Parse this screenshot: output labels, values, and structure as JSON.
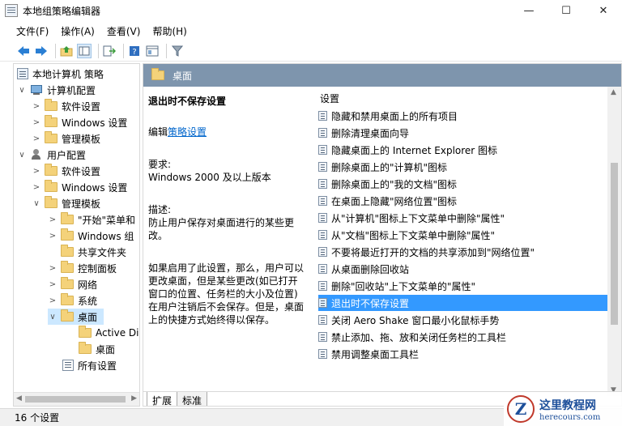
{
  "window": {
    "title": "本地组策略编辑器",
    "minimize_glyph": "—",
    "maximize_glyph": "☐",
    "close_glyph": "✕"
  },
  "menu": [
    "文件(F)",
    "操作(A)",
    "查看(V)",
    "帮助(H)"
  ],
  "toolbar_icons": [
    "back-arrow-icon",
    "forward-arrow-icon",
    "up-folder-icon",
    "show-hide-tree-icon",
    "export-list-icon",
    "help-icon",
    "properties-icon",
    "filter-icon"
  ],
  "tree": {
    "root": "本地计算机 策略",
    "computer_config": "计算机配置",
    "cc_software": "软件设置",
    "cc_windows": "Windows 设置",
    "cc_admin": "管理模板",
    "user_config": "用户配置",
    "uc_software": "软件设置",
    "uc_windows": "Windows 设置",
    "uc_admin": "管理模板",
    "start_menu": "\"开始\"菜单和",
    "win_components": "Windows 组",
    "shared_folders": "共享文件夹",
    "control_panel": "控制面板",
    "network": "网络",
    "system": "系统",
    "desktop": "桌面",
    "active_desktop": "Active Di",
    "desktop_sub": "桌面",
    "all_settings": "所有设置"
  },
  "right_header": "桌面",
  "description": {
    "title": "退出时不保存设置",
    "edit_prefix": "编辑",
    "edit_link": "策略设置",
    "requirements_label": "要求:",
    "requirements_value": "Windows 2000 及以上版本",
    "desc_label": "描述:",
    "desc_value": "防止用户保存对桌面进行的某些更改。",
    "detail": "如果启用了此设置，那么，用户可以更改桌面，但是某些更改(如已打开窗口的位置、任务栏的大小及位置)在用户注销后不会保存。但是，桌面上的快捷方式始终得以保存。"
  },
  "settings_header": "设置",
  "settings": [
    "隐藏和禁用桌面上的所有项目",
    "删除清理桌面向导",
    "隐藏桌面上的 Internet Explorer 图标",
    "删除桌面上的\"计算机\"图标",
    "删除桌面上的\"我的文档\"图标",
    "在桌面上隐藏\"网络位置\"图标",
    "从\"计算机\"图标上下文菜单中删除\"属性\"",
    "从\"文档\"图标上下文菜单中删除\"属性\"",
    "不要将最近打开的文档的共享添加到\"网络位置\"",
    "从桌面删除回收站",
    "删除\"回收站\"上下文菜单的\"属性\"",
    "退出时不保存设置",
    "关闭 Aero Shake 窗口最小化鼠标手势",
    "禁止添加、拖、放和关闭任务栏的工具栏",
    "禁用调整桌面工具栏"
  ],
  "selected_setting_index": 11,
  "tabs": [
    "扩展",
    "标准"
  ],
  "status": "16 个设置",
  "watermark": {
    "logo": "Z",
    "name": "这里教程网",
    "url": "herecours.com"
  }
}
